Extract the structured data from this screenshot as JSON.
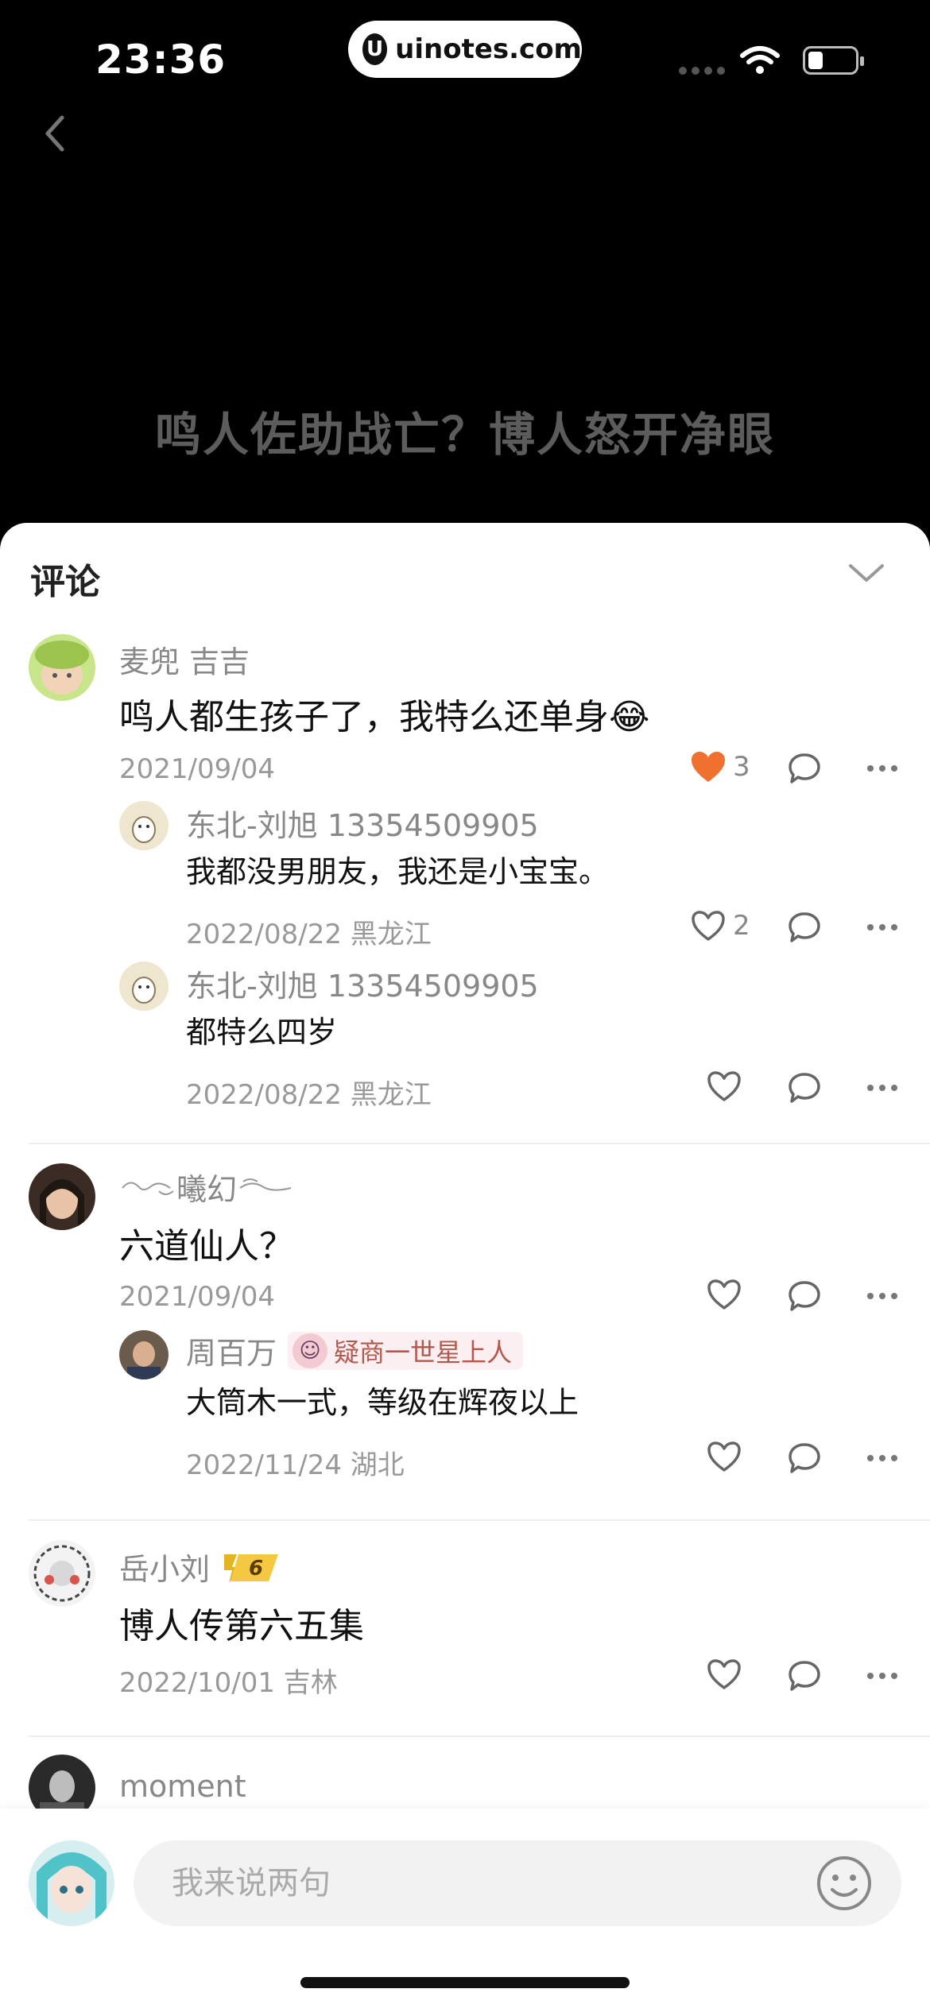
{
  "status_bar": {
    "time": "23:36",
    "watermark": "uinotes.com",
    "watermark_logo": "U"
  },
  "video": {
    "title": "鸣人佐助战亡？博人怒开净眼"
  },
  "sheet": {
    "title": "评论"
  },
  "comments": [
    {
      "user": "麦兜 吉吉",
      "text": "鸣人都生孩子了，我特么还单身😂",
      "date": "2021/09/04",
      "likes": "3",
      "liked": true,
      "replies": [
        {
          "user": "东北-刘旭 13354509905",
          "text": "我都没男朋友，我还是小宝宝。",
          "date": "2022/08/22 黑龙江",
          "likes": "2"
        },
        {
          "user": "东北-刘旭 13354509905",
          "text": "都特么四岁",
          "date": "2022/08/22 黑龙江",
          "likes": ""
        }
      ]
    },
    {
      "user": "曦幻",
      "text": "六道仙人？",
      "date": "2021/09/04",
      "likes": "",
      "replies": [
        {
          "user": "周百万",
          "badge": "疑商一世星上人",
          "text": "大筒木一式，等级在辉夜以上",
          "date": "2022/11/24 湖北",
          "likes": ""
        }
      ]
    },
    {
      "user": "岳小刘",
      "level_badge": "6",
      "text": "博人传第六五集",
      "date": "2022/10/01 吉林",
      "likes": ""
    },
    {
      "user": "moment"
    }
  ],
  "input": {
    "placeholder": "我来说两句"
  },
  "colors": {
    "like_active": "#f07030",
    "sheet_bg": "#ffffff",
    "screen_bg": "#000000"
  }
}
